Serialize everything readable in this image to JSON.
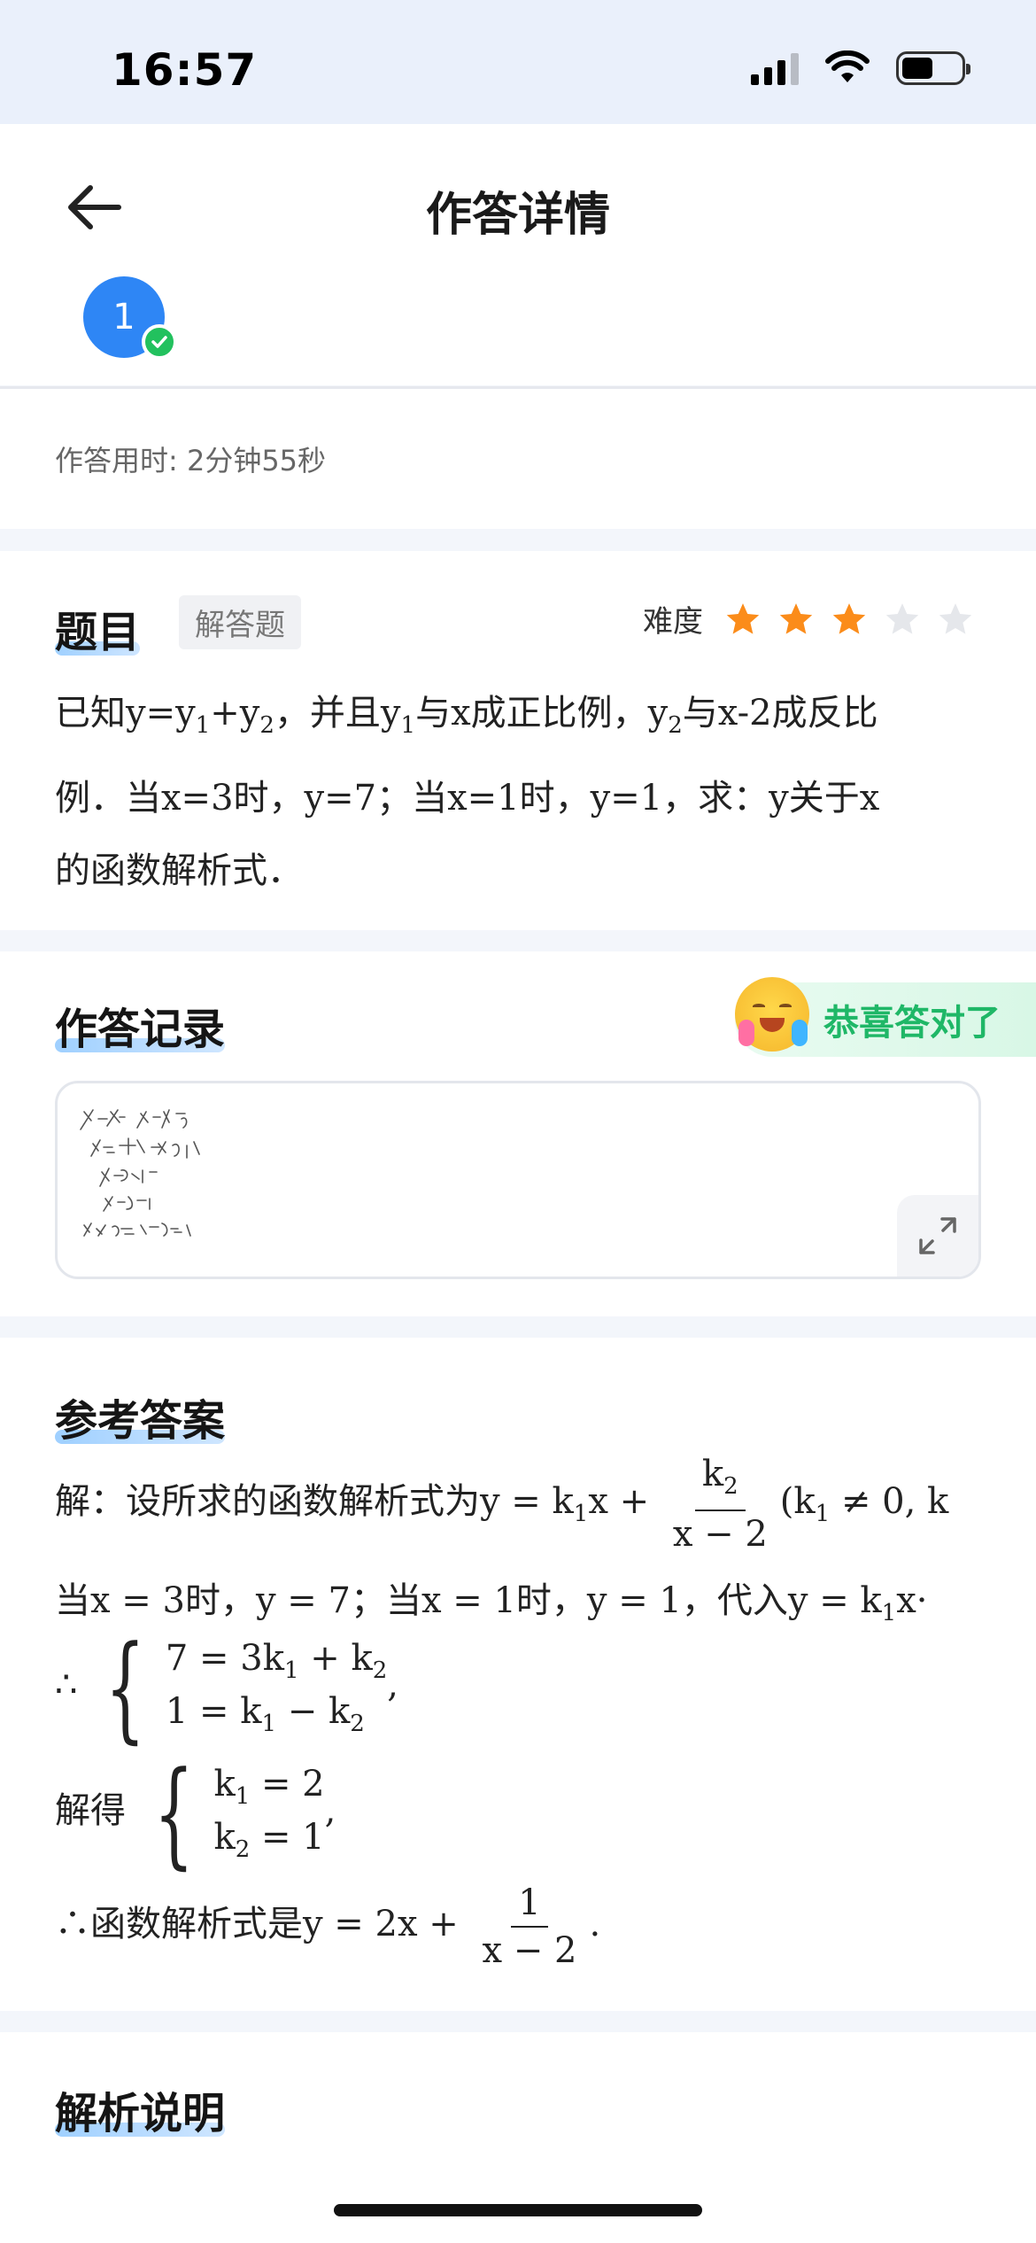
{
  "status": {
    "time": "16:57"
  },
  "header": {
    "title": "作答详情",
    "question_number": "1"
  },
  "timing": {
    "label": "作答用时: 2分钟55秒"
  },
  "question": {
    "title": "题目",
    "tag": "解答题",
    "difficulty_label": "难度",
    "difficulty_stars": 3,
    "difficulty_max": 5,
    "line1_a": "已知y=y",
    "line1_b": "+y",
    "line1_c": "，并且y",
    "line1_d": "与x成正比例，y",
    "line1_e": "与x-2成反比",
    "sub1": "1",
    "sub2": "2",
    "line2": "例．当x=3时，y=7；当x=1时，y=1，求：y关于x",
    "line3": "的函数解析式．"
  },
  "record": {
    "title": "作答记录",
    "result": "恭喜答对了"
  },
  "answer": {
    "title": "参考答案",
    "l1_prefix": "解：设所求的函数解析式为y = k",
    "l1_mid": "x +",
    "l1_frac_num": "k",
    "l1_frac_den": "x − 2",
    "l1_suffix": "(k",
    "l1_tail": " ≠ 0, k",
    "l2": "当x = 3时，y = 7；当x = 1时，y = 1，代入y = k",
    "l2_tail": "x·",
    "therefore": "∴",
    "sys1_r1": "7 = 3k",
    "sys1_r1b": " + k",
    "sys1_r2": "1 = k",
    "sys1_r2b": " − k",
    "comma": ",",
    "solve_label": "解得",
    "sys2_r1": "k",
    "sys2_r1b": " = 2",
    "sys2_r2": "k",
    "sys2_r2b": " = 1",
    "final_prefix": "∴函数解析式是y = 2x +",
    "final_num": "1",
    "final_den": "x − 2",
    "final_suffix": "."
  },
  "analysis": {
    "title": "解析说明"
  },
  "colors": {
    "accent": "#2e86f5",
    "success": "#1fb767",
    "star_on": "#fb8c1a",
    "star_off": "#e5e7eb"
  }
}
